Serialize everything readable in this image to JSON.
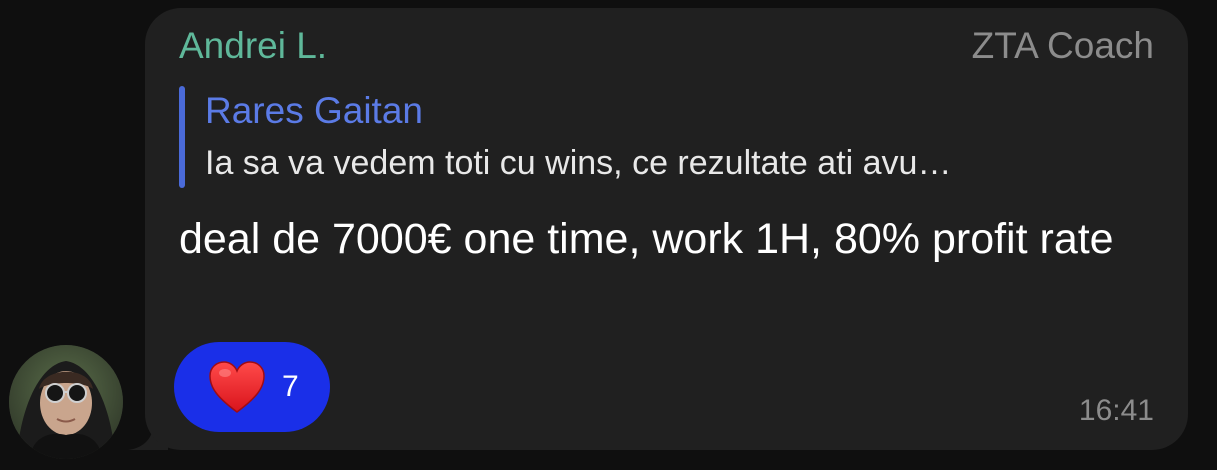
{
  "message": {
    "sender_name": "Andrei L.",
    "sender_role": "ZTA Coach",
    "reply": {
      "author": "Rares Gaitan",
      "text": "Ia sa va vedem toti cu wins, ce rezultate ati avu…"
    },
    "body": "deal de 7000€ one time, work 1H, 80% profit rate",
    "reaction": {
      "icon": "heart-icon",
      "count": "7"
    },
    "time": "16:41"
  },
  "colors": {
    "background": "#0f0f0f",
    "bubble": "#202020",
    "sender_name": "#5fb89a",
    "reply_accent": "#5b7be6",
    "reaction_pill": "#1a2fe8",
    "muted_text": "#8c8c8c"
  }
}
